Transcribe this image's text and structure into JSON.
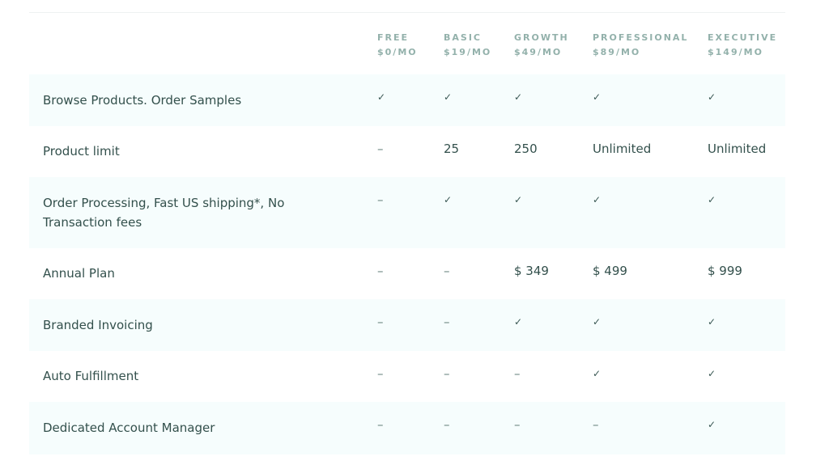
{
  "columns": [
    {
      "name": "FREE",
      "price": "$0/MO"
    },
    {
      "name": "BASIC",
      "price": "$19/MO"
    },
    {
      "name": "GROWTH",
      "price": "$49/MO"
    },
    {
      "name": "PROFESSIONAL",
      "price": "$89/MO"
    },
    {
      "name": "EXECUTIVE",
      "price": "$149/MO"
    }
  ],
  "rows": [
    {
      "feature": "Browse Products. Order Samples",
      "values": [
        "✓",
        "✓",
        "✓",
        "✓",
        "✓"
      ]
    },
    {
      "feature": "Product limit",
      "values": [
        "–",
        "25",
        "250",
        "Unlimited",
        "Unlimited"
      ]
    },
    {
      "feature": "Order Processing, Fast US shipping*, No Transaction fees",
      "values": [
        "–",
        "✓",
        "✓",
        "✓",
        "✓"
      ]
    },
    {
      "feature": "Annual Plan",
      "values": [
        "–",
        "–",
        "$ 349",
        "$ 499",
        "$ 999"
      ]
    },
    {
      "feature": "Branded Invoicing",
      "values": [
        "–",
        "–",
        "✓",
        "✓",
        "✓"
      ]
    },
    {
      "feature": "Auto Fulfillment",
      "values": [
        "–",
        "–",
        "–",
        "✓",
        "✓"
      ]
    },
    {
      "feature": "Dedicated Account Manager",
      "values": [
        "–",
        "–",
        "–",
        "–",
        "✓"
      ]
    }
  ]
}
